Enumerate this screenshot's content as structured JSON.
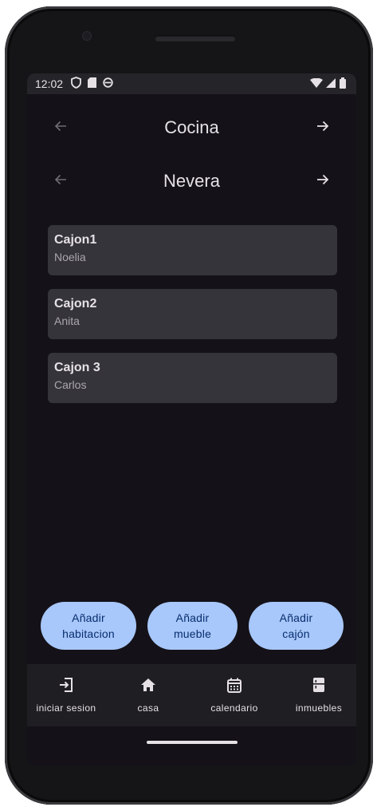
{
  "status_bar": {
    "time": "12:02"
  },
  "room_selector": {
    "title": "Cocina"
  },
  "furniture_selector": {
    "title": "Nevera"
  },
  "drawers": [
    {
      "title": "Cajon1",
      "owner": "Noelia"
    },
    {
      "title": "Cajon2",
      "owner": "Anita"
    },
    {
      "title": "Cajon 3",
      "owner": "Carlos"
    }
  ],
  "actions": {
    "add_room": {
      "line1": "Añadir",
      "line2": "habitacion"
    },
    "add_furniture": {
      "line1": "Añadir",
      "line2": "mueble"
    },
    "add_drawer": {
      "line1": "Añadir",
      "line2": "cajón"
    }
  },
  "bottom_nav": {
    "items": [
      {
        "label": "iniciar sesion",
        "icon": "login-icon"
      },
      {
        "label": "casa",
        "icon": "home-icon"
      },
      {
        "label": "calendario",
        "icon": "calendar-icon"
      },
      {
        "label": "inmuebles",
        "icon": "fridge-icon"
      }
    ]
  },
  "colors": {
    "background": "#141218",
    "card": "#36343b",
    "button": "#a8c7fa",
    "button_text": "#062e6f",
    "text_primary": "#e6e1e5",
    "text_secondary": "#aaa6ae",
    "nav_bar": "#1f1e23"
  }
}
